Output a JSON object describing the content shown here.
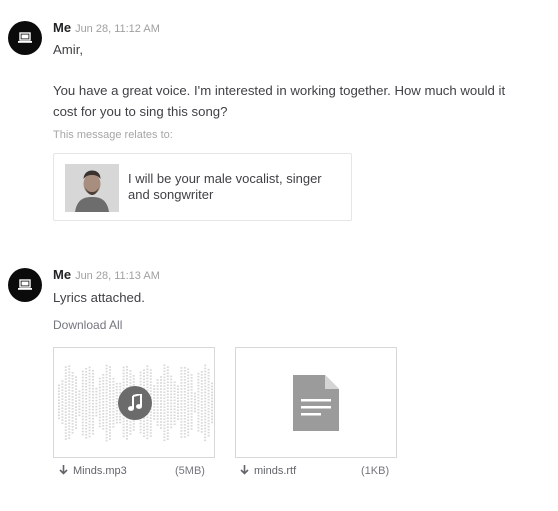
{
  "messages": [
    {
      "sender": "Me",
      "time": "Jun 28, 11:12 AM",
      "greeting": "Amir,",
      "body_line1": "You have a great voice. I'm interested in working together. How much would it",
      "body_line2": "cost for you to sing this song?",
      "relates_label": "This message relates to:",
      "gig": {
        "title_line1": "I will be your male vocalist, singer",
        "title_line2": "and songwriter"
      }
    },
    {
      "sender": "Me",
      "time": "Jun 28, 11:13 AM",
      "body": "Lyrics attached.",
      "download_all": "Download All",
      "attachments": [
        {
          "name": "Minds.mp3",
          "size": "(5MB)",
          "icon": "music-note-icon"
        },
        {
          "name": "minds.rtf",
          "size": "(1KB)",
          "icon": "document-icon"
        }
      ]
    }
  ]
}
